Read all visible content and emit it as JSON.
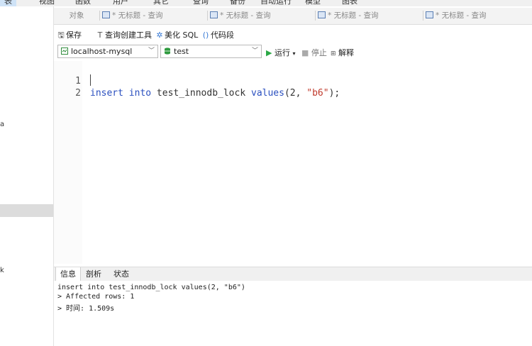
{
  "menu": {
    "items": [
      "表",
      "视图",
      "函数",
      "用户",
      "其它",
      "查询",
      "备份",
      "自动运行",
      "模型",
      "图表"
    ]
  },
  "sidebar": {
    "fragments": [
      "a",
      "k"
    ]
  },
  "tabs": {
    "objects": "对象",
    "query_tabs": [
      "* 无标题 - 查询",
      "* 无标题 - 查询",
      "* 无标题 - 查询",
      "* 无标题 - 查询"
    ]
  },
  "toolbar": {
    "save": "保存",
    "query_builder": "查询创建工具",
    "beautify": "美化 SQL",
    "code_snippet": "代码段"
  },
  "connection": {
    "value": "localhost-mysql",
    "database": "test",
    "run": "运行",
    "stop": "停止",
    "explain": "解释"
  },
  "editor": {
    "lines": [
      {
        "num": "1",
        "kw1": "insert",
        "kw2": "into",
        "table": " test_innodb_lock ",
        "kw3": "values",
        "pre": "(2, ",
        "str": "\"b6\"",
        "post": ");"
      },
      {
        "num": "2"
      }
    ]
  },
  "result": {
    "tabs": [
      "信息",
      "剖析",
      "状态"
    ],
    "lines": [
      "insert into test_innodb_lock values(2, \"b6\")",
      "> Affected rows: 1",
      "> 时间: 1.509s"
    ]
  }
}
